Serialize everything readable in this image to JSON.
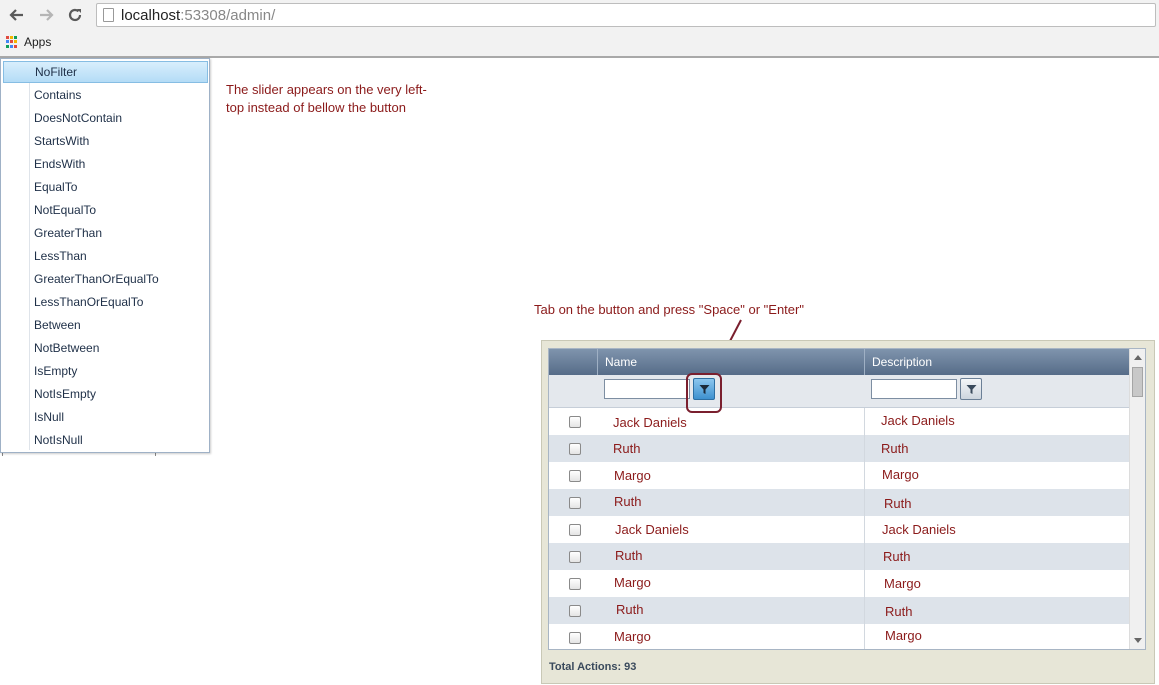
{
  "browser": {
    "url_host": "localhost",
    "url_rest": ":53308/admin/",
    "bookmarks": {
      "apps_label": "Apps"
    }
  },
  "filter_menu": {
    "selected": "NoFilter",
    "items": [
      "NoFilter",
      "Contains",
      "DoesNotContain",
      "StartsWith",
      "EndsWith",
      "EqualTo",
      "NotEqualTo",
      "GreaterThan",
      "LessThan",
      "GreaterThanOrEqualTo",
      "LessThanOrEqualTo",
      "Between",
      "NotBetween",
      "IsEmpty",
      "NotIsEmpty",
      "IsNull",
      "NotIsNull"
    ]
  },
  "annotations": {
    "slider_note_line1": "The slider appears on the very left-",
    "slider_note_line2": "top instead of bellow the button",
    "tab_note": "Tab on the button and press \"Space\" or \"Enter\""
  },
  "grid": {
    "columns": [
      "Name",
      "Description"
    ],
    "filter_values": [
      "",
      ""
    ],
    "rows": [
      {
        "name": "Jack Daniels",
        "description": "Jack Daniels"
      },
      {
        "name": "Ruth",
        "description": "Ruth"
      },
      {
        "name": "Margo",
        "description": "Margo"
      },
      {
        "name": "Ruth",
        "description": "Ruth"
      },
      {
        "name": "Jack Daniels",
        "description": "Jack Daniels"
      },
      {
        "name": "Ruth",
        "description": "Ruth"
      },
      {
        "name": "Margo",
        "description": "Margo"
      },
      {
        "name": "Ruth",
        "description": "Ruth"
      },
      {
        "name": "Margo",
        "description": "Margo"
      }
    ],
    "footer": "Total Actions: 93"
  },
  "colors": {
    "annotation": "#8b1a1a",
    "header": "#667b96",
    "alt_row": "#dde3ea",
    "panel_bg": "#e7e6d7"
  }
}
